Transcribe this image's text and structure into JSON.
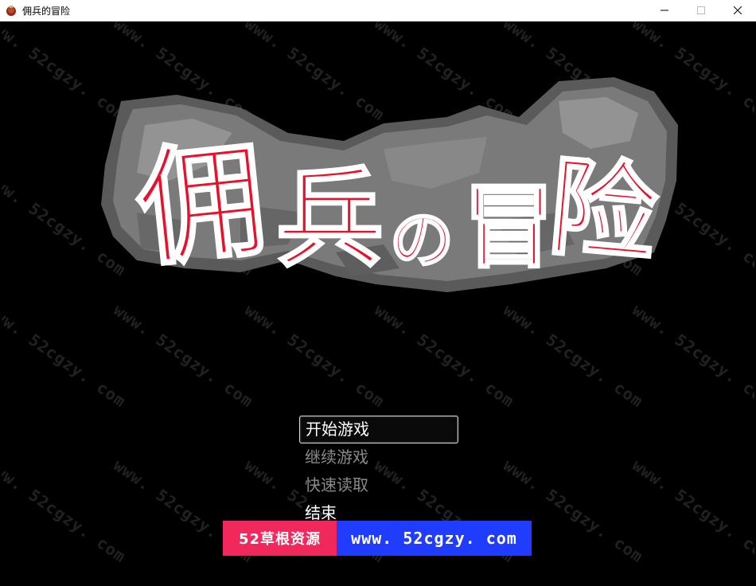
{
  "window": {
    "title": "佣兵的冒险",
    "icon": "game-app-icon",
    "controls": [
      "minimize-icon",
      "maximize-icon",
      "close-icon"
    ]
  },
  "game": {
    "logo_text": "佣兵の冒险",
    "logo_chars": [
      "佣",
      "兵",
      "の",
      "冒",
      "险"
    ],
    "colors": {
      "logo_red": "#e8102a",
      "rock_gray": "#6e6e6e",
      "background": "#000000"
    },
    "menu": {
      "items": [
        {
          "label": "开始游戏",
          "state": "selected"
        },
        {
          "label": "继续游戏",
          "state": "disabled"
        },
        {
          "label": "快速读取",
          "state": "disabled"
        },
        {
          "label": "结束",
          "state": "enabled"
        }
      ]
    },
    "watermark_text": "www. 52cgzy. com"
  },
  "banner": {
    "left_text": "52草根资源",
    "right_text": "www. 52cgzy. com",
    "left_color": "#f0285c",
    "right_color": "#1f3cff"
  }
}
